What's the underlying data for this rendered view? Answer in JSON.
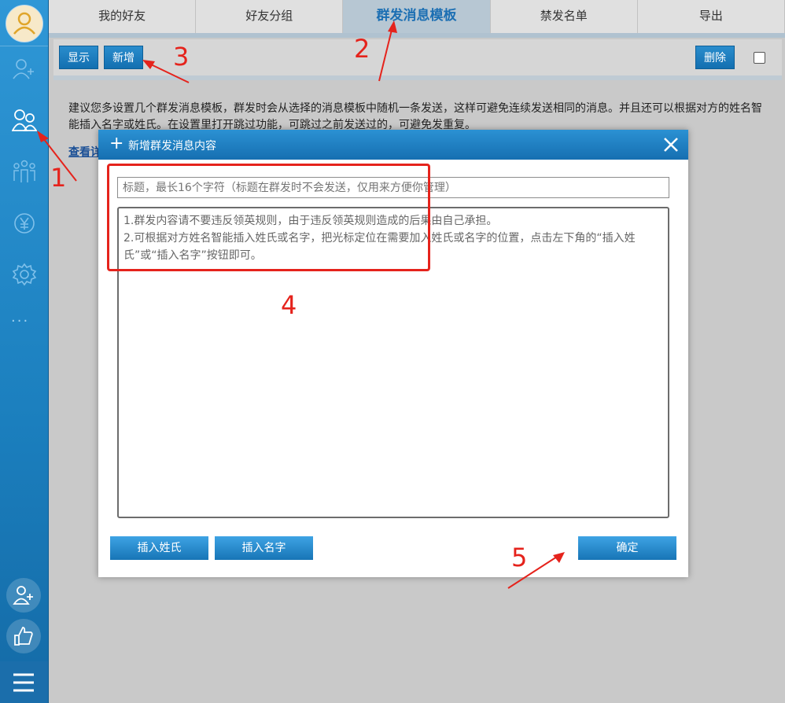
{
  "sidebar": {
    "items": [
      {
        "icon": "avatar-icon"
      },
      {
        "icon": "add-friend-icon"
      },
      {
        "icon": "friends-icon"
      },
      {
        "icon": "group-people-icon"
      },
      {
        "icon": "yuan-icon"
      },
      {
        "icon": "settings-gear-icon"
      },
      {
        "icon": "more-dots-icon"
      },
      {
        "icon": "add-user-round-icon"
      },
      {
        "icon": "thumbs-up-icon"
      },
      {
        "icon": "menu-icon"
      }
    ],
    "more_label": "···"
  },
  "tabs": [
    {
      "label": "我的好友",
      "active": false
    },
    {
      "label": "好友分组",
      "active": false
    },
    {
      "label": "群发消息模板",
      "active": true
    },
    {
      "label": "禁发名单",
      "active": false
    },
    {
      "label": "导出",
      "active": false
    }
  ],
  "toolbar": {
    "show_label": "显示",
    "add_label": "新增",
    "delete_label": "删除"
  },
  "notice": {
    "text": "建议您多设置几个群发消息模板，群发时会从选择的消息模板中随机一条发送，这样可避免连续发送相同的消息。并且还可以根据对方的姓名智能插入名字或姓氏。在设置里打开跳过功能，可跳过之前发送过的，可避免发重复。",
    "link": "查看详"
  },
  "dialog": {
    "title": "新增群发消息内容",
    "plus": "+",
    "title_placeholder": "标题，最长16个字符（标题在群发时不会发送，仅用来方便你管理）",
    "content_line1": "1.群发内容请不要违反领英规则，由于违反领英规则造成的后果由自己承担。",
    "content_line2": "2.可根据对方姓名智能插入姓氏或名字，把光标定位在需要加入姓氏或名字的位置，点击左下角的“插入姓氏”或“插入名字”按钮即可。",
    "insert_surname": "插入姓氏",
    "insert_name": "插入名字",
    "confirm": "确定"
  },
  "annotations": [
    "1",
    "2",
    "3",
    "4",
    "5"
  ],
  "colors": {
    "accent": "#1c6fb3",
    "annotation": "#e5231c",
    "sidebar": "#1b7fbe"
  }
}
